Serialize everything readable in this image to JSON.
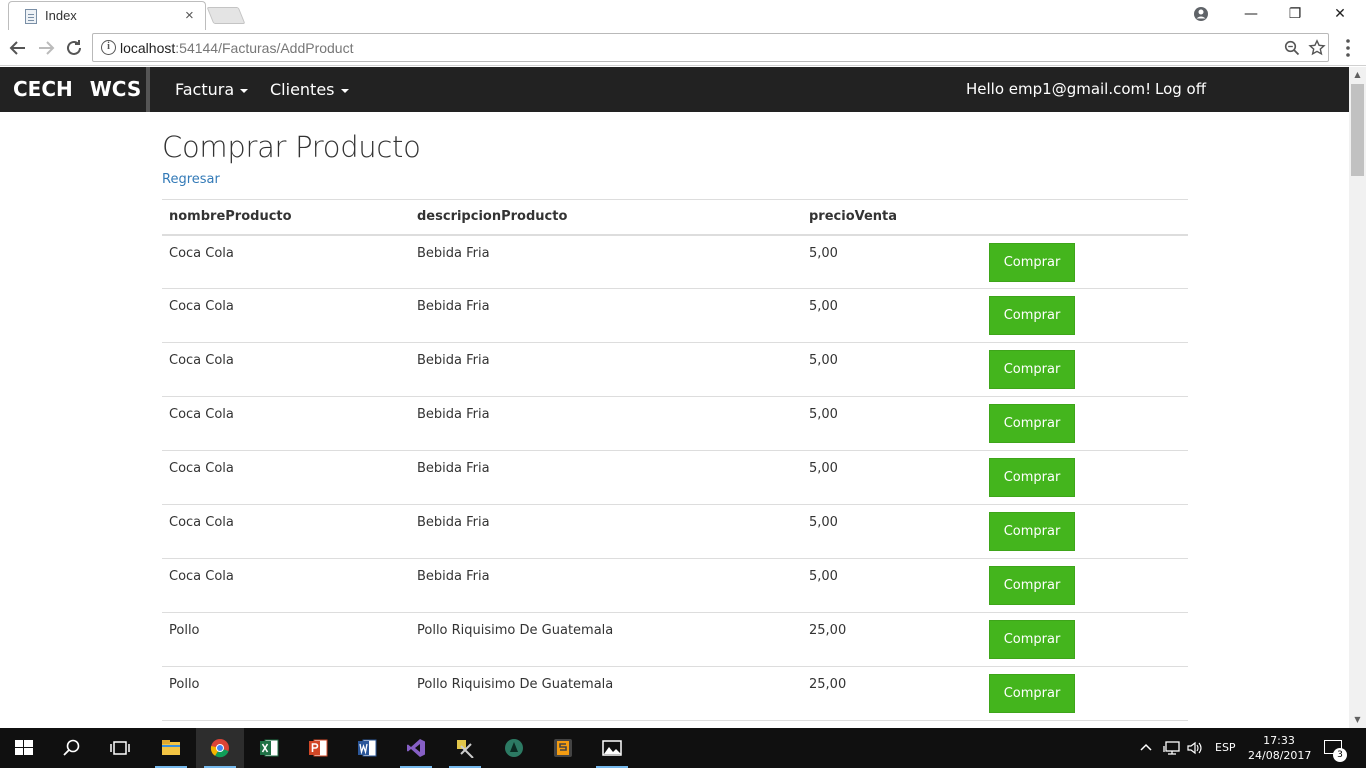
{
  "browser": {
    "tab_title": "Index",
    "tab_close": "×",
    "url_host": "localhost",
    "url_path": ":54144/Facturas/AddProduct",
    "window_controls": {
      "minimize": "—",
      "restore": "❐",
      "close": "✕"
    }
  },
  "navbar": {
    "brand": "CECH WCS",
    "menus": [
      {
        "label": "Factura"
      },
      {
        "label": "Clientes"
      }
    ],
    "greeting": "Hello emp1@gmail.com!",
    "logoff": "Log off"
  },
  "page": {
    "title": "Comprar Producto",
    "back_link": "Regresar",
    "columns": [
      "nombreProducto",
      "descripcionProducto",
      "precioVenta"
    ],
    "buy_label": "Comprar",
    "rows": [
      {
        "nombre": "Coca Cola",
        "descripcion": "Bebida Fria",
        "precio": "5,00"
      },
      {
        "nombre": "Coca Cola",
        "descripcion": "Bebida Fria",
        "precio": "5,00"
      },
      {
        "nombre": "Coca Cola",
        "descripcion": "Bebida Fria",
        "precio": "5,00"
      },
      {
        "nombre": "Coca Cola",
        "descripcion": "Bebida Fria",
        "precio": "5,00"
      },
      {
        "nombre": "Coca Cola",
        "descripcion": "Bebida Fria",
        "precio": "5,00"
      },
      {
        "nombre": "Coca Cola",
        "descripcion": "Bebida Fria",
        "precio": "5,00"
      },
      {
        "nombre": "Coca Cola",
        "descripcion": "Bebida Fria",
        "precio": "5,00"
      },
      {
        "nombre": "Pollo",
        "descripcion": "Pollo Riquisimo De Guatemala",
        "precio": "25,00"
      },
      {
        "nombre": "Pollo",
        "descripcion": "Pollo Riquisimo De Guatemala",
        "precio": "25,00"
      },
      {
        "nombre": "",
        "descripcion": "",
        "precio": ""
      }
    ]
  },
  "colors": {
    "navbar_bg": "#222222",
    "buy_button": "#44b51d",
    "link": "#337ab7"
  },
  "taskbar": {
    "apps": [
      "start-icon",
      "search-icon",
      "task-view-icon",
      "file-explorer-icon",
      "chrome-icon",
      "excel-icon",
      "powerpoint-icon",
      "word-icon",
      "visual-studio-icon",
      "tools-icon",
      "app-icon",
      "sublime-text-icon",
      "photos-icon"
    ],
    "language": "ESP",
    "time": "17:33",
    "date": "24/08/2017",
    "notifications": "3"
  }
}
